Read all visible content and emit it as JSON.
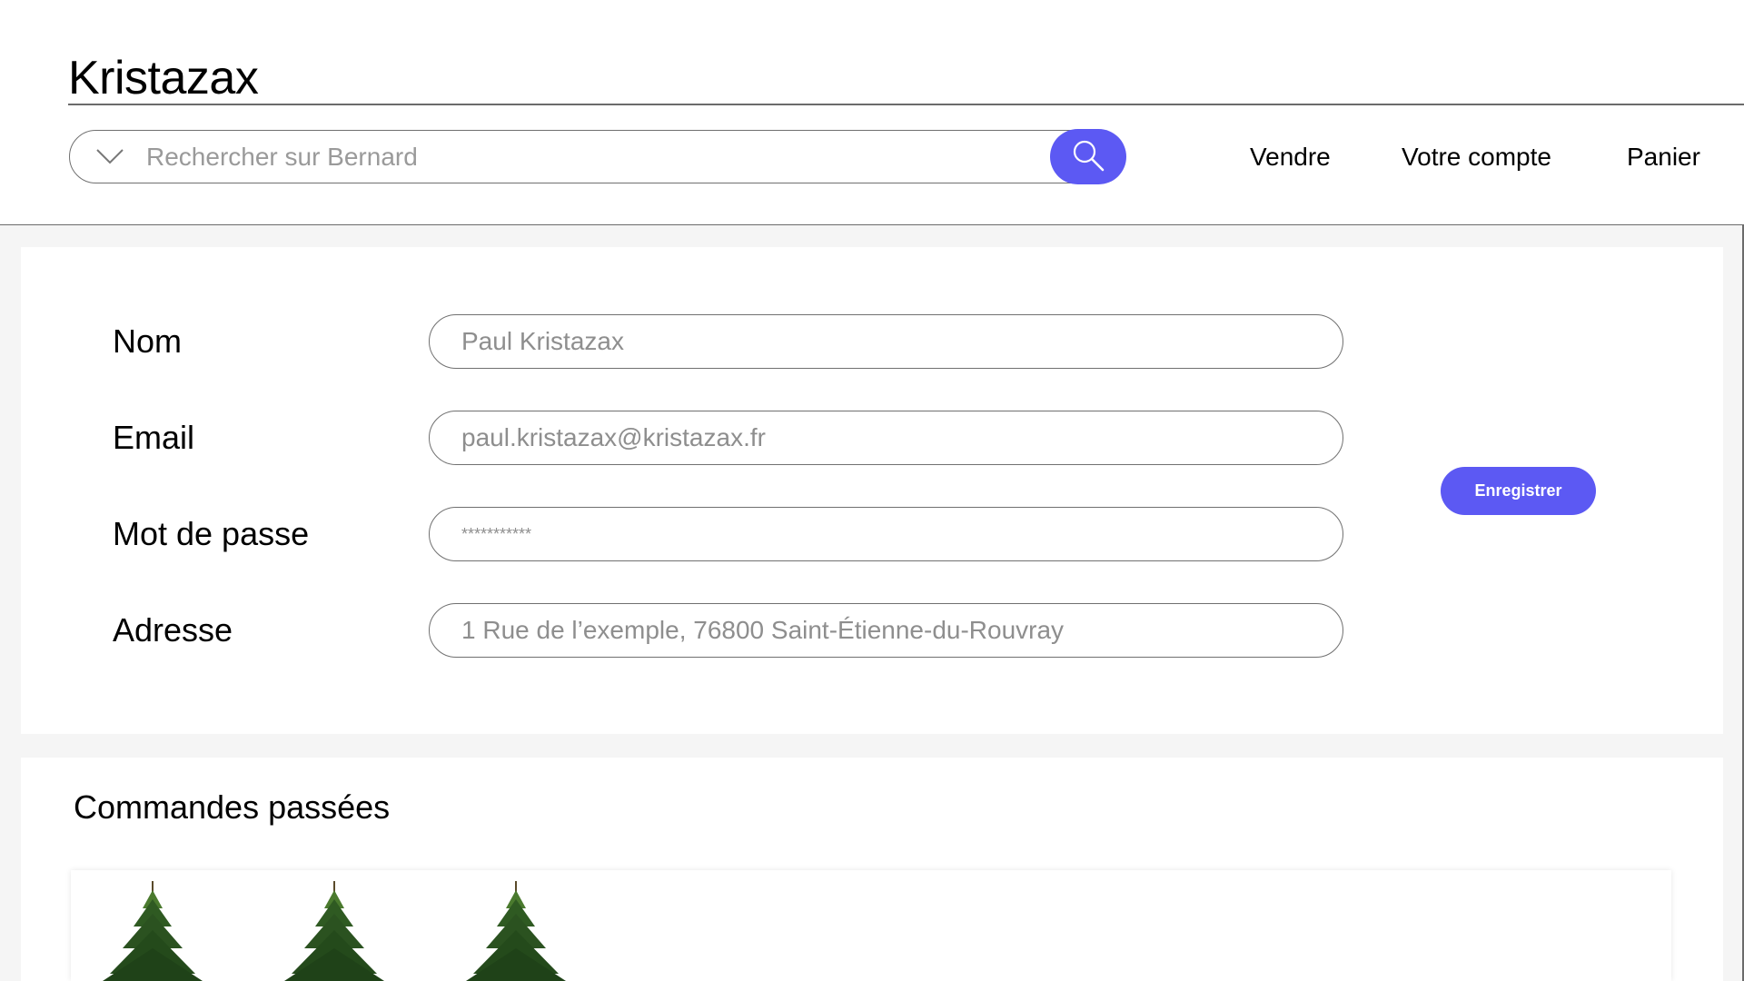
{
  "header": {
    "brand": "Kristazax",
    "search": {
      "placeholder": "Rechercher sur Bernard",
      "value": ""
    },
    "nav": [
      {
        "label": "Vendre"
      },
      {
        "label": "Votre compte"
      },
      {
        "label": "Panier"
      }
    ]
  },
  "profile": {
    "fields": [
      {
        "label": "Nom",
        "value": "Paul Kristazax"
      },
      {
        "label": "Email",
        "value": "paul.kristazax@kristazax.fr"
      },
      {
        "label": "Mot de passe",
        "value": "***********"
      },
      {
        "label": "Adresse",
        "value": "1 Rue de l’exemple, 76800 Saint-Étienne-du-Rouvray"
      }
    ],
    "save_label": "Enregistrer"
  },
  "orders": {
    "title": "Commandes passées",
    "items": [
      {
        "icon": "fir-tree-image"
      },
      {
        "icon": "fir-tree-image"
      },
      {
        "icon": "fir-tree-image"
      }
    ]
  },
  "colors": {
    "accent": "#5c59f3",
    "border": "#707070",
    "placeholder_text": "#9a9a9a",
    "content_background": "#f5f5f5"
  }
}
